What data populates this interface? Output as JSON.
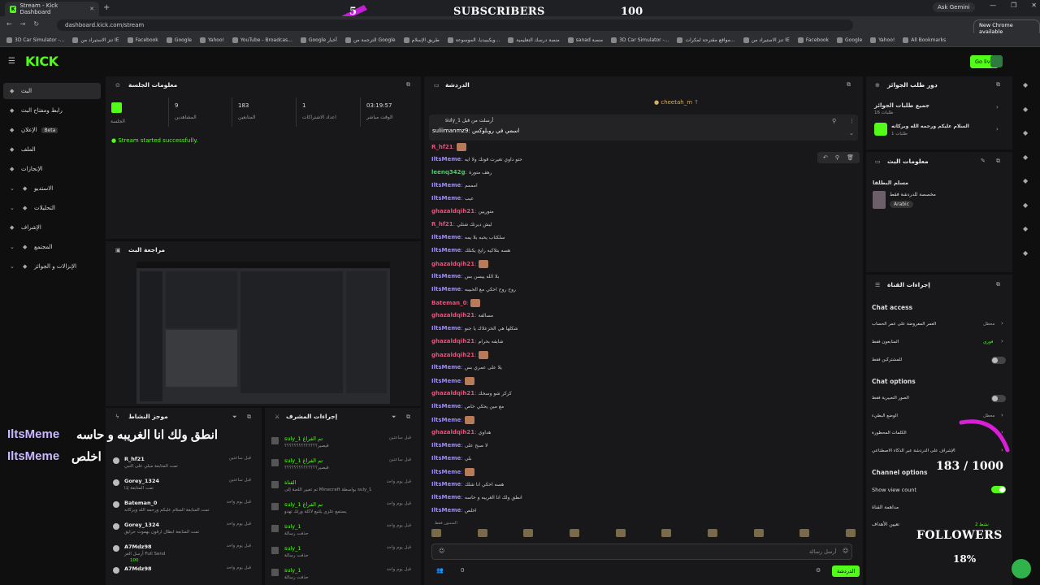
{
  "browser": {
    "tab_title": "Stream - Kick Dashboard",
    "url": "dashboard.kick.com/stream",
    "gemini": "Ask Gemini",
    "new_chrome": "New Chrome available",
    "bookmarks": [
      "3D Car Simulator -...",
      "تنز الاستيراد من IE",
      "Facebook",
      "Google",
      "Yahoo!",
      "YouTube - Broadcas...",
      "Google أخبار",
      "الترجمة من Google",
      "طريق الإسلام",
      "ويكيبيديا، الموسوعة...",
      "منصة درسك التعليمية",
      "sanad منصة",
      "3D Car Simulator -...",
      "مواقع مقترحة لمكرات...",
      "تنز الاستيراد من IE",
      "Facebook",
      "Google",
      "Yahoo!",
      "All Bookmarks"
    ]
  },
  "overlay": {
    "sub_count": "5",
    "sub_label": "SUBSCRIBERS",
    "sub_goal": "100",
    "msg1_text": "انطق ولك انا الغريبه و حاسه",
    "msg1_user": "IltsMeme",
    "msg2_text": "اخلص",
    "msg2_user": "IltsMeme",
    "follow_count": "183 / 1000",
    "followers_label": "FOLLOWERS",
    "pct": "18%"
  },
  "kick": {
    "logo": "KICK",
    "go_live": "Go live"
  },
  "sidebar": {
    "items": [
      {
        "label": "البث",
        "icon": "live-icon"
      },
      {
        "label": "رابط ومفتاح البث",
        "icon": "link-icon"
      },
      {
        "label": "الإعلان",
        "icon": "ad-icon",
        "badge": "Beta"
      },
      {
        "label": "الملف",
        "icon": "profile-icon"
      },
      {
        "label": "الإنجازات",
        "icon": "trophy-icon"
      },
      {
        "label": "الاستديو",
        "icon": "studio-icon"
      },
      {
        "label": "التحليلات",
        "icon": "analytics-icon"
      },
      {
        "label": "الإشراف",
        "icon": "moderation-icon"
      },
      {
        "label": "المجتمع",
        "icon": "community-icon"
      },
      {
        "label": "الإنزالات و الجوائز",
        "icon": "drops-icon"
      }
    ]
  },
  "session": {
    "title": "معلومات الجلسة",
    "stats": [
      {
        "value": "9",
        "label": "المشاهدين"
      },
      {
        "value": "183",
        "label": "المتابعين"
      },
      {
        "value": "1",
        "label": "اعداد الاشتراكات"
      },
      {
        "value": "03:19:57",
        "label": "الوقت مباشر"
      }
    ],
    "cc_label": "الجلسة",
    "status": "Stream started successfully."
  },
  "preview": {
    "title": "مراجعة البث"
  },
  "activity": {
    "title": "موجز النشاط",
    "items": [
      {
        "name": "R_hf21",
        "desc": "تمت المتابعة مبلي على النبي",
        "time": "قبل ساعتين"
      },
      {
        "name": "Gorey_1324",
        "desc": "تمت المتابعة إذا",
        "time": "قبل ساعتين"
      },
      {
        "name": "Bateman_0",
        "desc": "تمت المتابعة السلام عليكم ورحمه الله وبركاته",
        "time": "قبل يوم واحد"
      },
      {
        "name": "Gorey_1324",
        "desc": "تمت المتابعة ابطال ارقون بهموت حزايق",
        "time": "قبل يوم واحد"
      },
      {
        "name": "A7Mdz98",
        "desc": "أرسل الغر Full Send",
        "time": "قبل يوم واحد",
        "extra": "100"
      },
      {
        "name": "A7Mdz98",
        "desc": "",
        "time": "قبل يوم واحد"
      }
    ]
  },
  "modactions": {
    "title": "إجراءات المشرف",
    "items": [
      {
        "name": "suly_1 تم الفراغ",
        "desc": "قيصير؟؟؟؟؟؟؟؟؟؟؟؟؟؟",
        "time": "قبل ساعتين"
      },
      {
        "name": "suly_1 تم الفراغ",
        "desc": "قيصير؟؟؟؟؟؟؟؟؟؟؟؟؟؟",
        "time": "قبل ساعتين"
      },
      {
        "name": "القناة",
        "desc": "تم تغيير اللعبة إلى Minecraft بواسطة suly_1",
        "time": "قبل يوم واحد"
      },
      {
        "name": "suly_1 تم الفراغ",
        "desc": "يستمع علزي يلتبع لاكلة ورتك تهدو",
        "time": "قبل يوم واحد"
      },
      {
        "name": "suly_1",
        "desc": "حذفت رسالة",
        "time": "قبل يوم واحد"
      },
      {
        "name": "suly_1",
        "desc": "حذفت رسالة",
        "time": "قبل يوم واحد"
      },
      {
        "name": "suly_1",
        "desc": "حذفت رسالة",
        "time": "قبل يوم واحد"
      }
    ]
  },
  "chat": {
    "title": "الدردشة",
    "host_badge": "cheetah_m",
    "pinned_sender": "suly_1 أرسلت من قبل",
    "pinned_text": "suliimanmz9: اسمي في روبلوكس",
    "input_placeholder": "أرسل رسالة",
    "send_label": "الدردشة",
    "people_count": "0",
    "messages": [
      {
        "user": "R_hf21",
        "color": "#e0557a",
        "text": "",
        "emote": true
      },
      {
        "user": "IltsMeme",
        "color": "#9b8cf2",
        "text": "حتو داوي تغيرت قوتك ولا ايه"
      },
      {
        "user": "leenq342g",
        "color": "#53c96a",
        "text": "رهف متورة"
      },
      {
        "user": "IltsMeme",
        "color": "#9b8cf2",
        "text": "امممم"
      },
      {
        "user": "IltsMeme",
        "color": "#9b8cf2",
        "text": "عيب"
      },
      {
        "user": "ghazaldqih21",
        "color": "#e0557a",
        "text": "متوريين"
      },
      {
        "user": "R_hf21",
        "color": "#e0557a",
        "text": "ليش ديرتك شتلي"
      },
      {
        "user": "IltsMeme",
        "color": "#9b8cf2",
        "text": "سلكتاب يحبه بلا يمه"
      },
      {
        "user": "IltsMeme",
        "color": "#9b8cf2",
        "text": "هسه بتلاكيه رايح يكتلك"
      },
      {
        "user": "ghazaldqih21",
        "color": "#e0557a",
        "text": "",
        "emote": true
      },
      {
        "user": "IltsMeme",
        "color": "#9b8cf2",
        "text": "بلا الله ييسن بس"
      },
      {
        "user": "IltsMeme",
        "color": "#9b8cf2",
        "text": "روح روح احكي مع الحبيبه"
      },
      {
        "user": "Bateman_0",
        "color": "#e0557a",
        "text": "",
        "emote": true
      },
      {
        "user": "ghazaldqih21",
        "color": "#e0557a",
        "text": "مسالفة"
      },
      {
        "user": "IltsMeme",
        "color": "#9b8cf2",
        "text": "شكلها هي الخزعلاك يا جنو"
      },
      {
        "user": "ghazaldqih21",
        "color": "#e0557a",
        "text": "شايفه بحرام"
      },
      {
        "user": "ghazaldqih21",
        "color": "#e0557a",
        "text": "",
        "emote": true
      },
      {
        "user": "IltsMeme",
        "color": "#9b8cf2",
        "text": "يلا على عمري بس"
      },
      {
        "user": "IltsMeme",
        "color": "#9b8cf2",
        "text": "",
        "emote": true
      },
      {
        "user": "ghazaldqih21",
        "color": "#e0557a",
        "text": "كركر شو وسخك"
      },
      {
        "user": "IltsMeme",
        "color": "#9b8cf2",
        "text": "مع مين يحكي خاص"
      },
      {
        "user": "IltsMeme",
        "color": "#9b8cf2",
        "text": "",
        "emote": true
      },
      {
        "user": "ghazaldqih21",
        "color": "#e0557a",
        "text": "هداوي"
      },
      {
        "user": "IltsMeme",
        "color": "#9b8cf2",
        "text": "لا صبح على"
      },
      {
        "user": "IltsMeme",
        "color": "#9b8cf2",
        "text": "بلي"
      },
      {
        "user": "IltsMeme",
        "color": "#9b8cf2",
        "text": "",
        "emote": true
      },
      {
        "user": "IltsMeme",
        "color": "#9b8cf2",
        "text": "هسه احكي انا شلك"
      },
      {
        "user": "IltsMeme",
        "color": "#9b8cf2",
        "text": "انطق ولك انا الغريبه و حاسه"
      },
      {
        "user": "IltsMeme",
        "color": "#9b8cf2",
        "text": "اخلص"
      }
    ],
    "pinned_area_label": "المثبتون فقط"
  },
  "queue": {
    "title": "دور طلب الجوائز",
    "all_label": "جميع طلبات الجوائز",
    "all_count": "طلبات 16",
    "item_label": "السلام عليكم ورحمه الله وبركاته",
    "item_sub": "طلبات 1"
  },
  "streaminfo": {
    "title": "معلومات البث",
    "name": "مسلم البطلقا",
    "category": "مخصصة للدردشة فقط",
    "lang": "Arabic"
  },
  "channel": {
    "title": "إجراءات القناة",
    "chat_access": "Chat access",
    "access_rows": [
      {
        "label": "العمر المفروضة على عمر الحساب",
        "value": "معطل"
      },
      {
        "label": "المتابعون فقط",
        "value": "فوري"
      },
      {
        "label": "للمشتركين فقط",
        "value": ""
      }
    ],
    "chat_options": "Chat options",
    "opt_rows": [
      {
        "label": "الصور التعبيرية فقط",
        "value": ""
      },
      {
        "label": "الوضع البطيء",
        "value": "معطل"
      },
      {
        "label": "الكلمات المحظورة",
        "value": ""
      },
      {
        "label": "الإشراف على الدردشة عبر الذكاء الاصطناعي",
        "value": ""
      }
    ],
    "channel_options": "Channel options",
    "show_view_count": "Show view count",
    "chan_rows": [
      "مداهمة القناة",
      "تعيين الأهداف"
    ],
    "goal_value": "2 نشط"
  }
}
